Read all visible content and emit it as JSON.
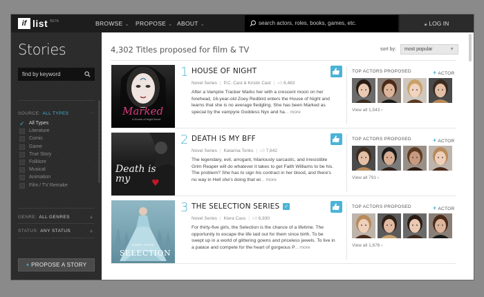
{
  "nav": {
    "logo_if": "if",
    "logo_list": "list",
    "logo_beta": "BETA",
    "browse": "BROWSE",
    "propose": "PROPOSE",
    "about": "ABOUT",
    "search_placeholder": "search actors, roles, books, games, etc.",
    "login": "LOG IN"
  },
  "sidebar": {
    "title": "Stories",
    "keyword_placeholder": "find by keyword",
    "source_label": "SOURCE:",
    "source_value": "ALL TYPES",
    "types": [
      {
        "label": "All Types",
        "checked": true
      },
      {
        "label": "Literature",
        "checked": false
      },
      {
        "label": "Comic",
        "checked": false
      },
      {
        "label": "Game",
        "checked": false
      },
      {
        "label": "True Story",
        "checked": false
      },
      {
        "label": "Folklore",
        "checked": false
      },
      {
        "label": "Musical",
        "checked": false
      },
      {
        "label": "Animation",
        "checked": false
      },
      {
        "label": "Film / TV Remake",
        "checked": false
      }
    ],
    "genre_label": "GENRE:",
    "genre_value": "ALL GENRES",
    "status_label": "STATUS:",
    "status_value": "ANY STATUS",
    "propose_button": "PROPOSE A STORY"
  },
  "main": {
    "count": "4,302",
    "heading_suffix": "Titles proposed for film & TV",
    "sort_label": "sort by:",
    "sort_value": "most popular",
    "cards": [
      {
        "rank": "1",
        "title": "HOUSE OF NIGHT",
        "verified": false,
        "type": "Novel Series",
        "author": "P.C. Cast & Kristin Cast",
        "likes": "8,463",
        "desc": "After a Vampire Tracker Marks her with a crescent moon on her forehead, 16-year-old Zoey Redbird enters the House of Night and learns that she is no average fledgling. She has been Marked as special by the vampyre Goddess Nyx and ha",
        "more": "... more",
        "actors_label": "TOP ACTORS PROPOSED",
        "add_actor": "ACTOR",
        "view_all": "View all 1,543",
        "poster_text": "Marked",
        "poster_sub": "A House of Night Novel"
      },
      {
        "rank": "2",
        "title": "DEATH IS MY BFF",
        "verified": false,
        "type": "Novel Series",
        "author": "Katarina Tonks",
        "likes": "7,642",
        "desc": "The legendary, evil, arrogant, hilariously sarcastic, and irresistible Grim Reaper will do whatever it takes to get Faith Williams to be his. The problem? She has to sign his contract in her blood, and there's no way in Hell she's doing that wi",
        "more": "... more",
        "actors_label": "TOP ACTORS PROPOSED",
        "add_actor": "ACTOR",
        "view_all": "View all 791",
        "poster_text": "Death is my",
        "poster_sub": ""
      },
      {
        "rank": "3",
        "title": "THE SELECTION SERIES",
        "verified": true,
        "type": "Novel Series",
        "author": "Kiera Cass",
        "likes": "6,930",
        "desc": "For thirty-five girls, the Selection is the chance of a lifetime. The opportunity to escape the life laid out for them since birth. To be swept up in a world of glittering gowns and priceless jewels. To live in a palace and compete for the heart of gorgeous P",
        "more": "... more",
        "actors_label": "TOP ACTORS PROPOSED",
        "add_actor": "ACTOR",
        "view_all": "View all 1,676",
        "poster_text": "SELECTION",
        "poster_sub": "KIERA CASS"
      }
    ]
  },
  "colors": {
    "accent": "#4ab3d6",
    "topbar": "#1d1d1d",
    "sidebar": "#2a2a2a"
  }
}
